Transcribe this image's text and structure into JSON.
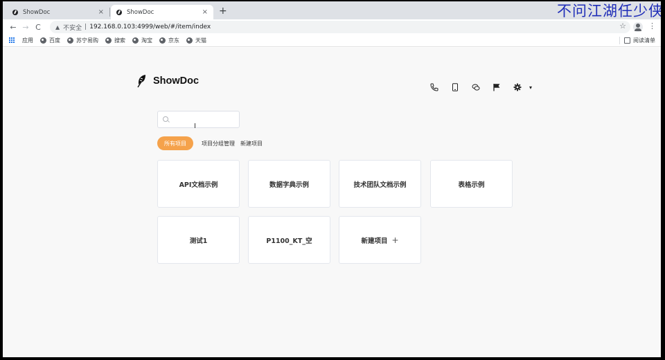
{
  "browser": {
    "tabs": [
      {
        "title": "ShowDoc",
        "close": "×",
        "active": false
      },
      {
        "title": "ShowDoc",
        "close": "×",
        "active": true
      }
    ],
    "new_tab": "+",
    "back": "←",
    "forward": "→",
    "reload": "C",
    "security_warning": "▲",
    "insecure_label": "不安全",
    "separator": "|",
    "url": "192.168.0.103:4999/web/#/item/index",
    "star": "☆",
    "menu": "⋮",
    "bookmarks": [
      "应用",
      "百度",
      "苏宁易购",
      "搜索",
      "淘宝",
      "京东",
      "天猫"
    ],
    "reading_list": "阅读清单"
  },
  "overlay_text": "不问江湖任少侠",
  "app": {
    "brand": "ShowDoc",
    "header_icons": [
      "phone-icon",
      "tablet-icon",
      "chat-icon",
      "flag-icon",
      "gear-icon"
    ],
    "caret": "▾",
    "search": {
      "value": "",
      "placeholder": ""
    },
    "cursor": "I",
    "filters": {
      "all_projects": "所有项目",
      "group_manage": "项目分组管理",
      "new_project": "新建项目"
    },
    "projects": [
      "API文档示例",
      "数据字典示例",
      "技术团队文档示例",
      "表格示例",
      "测试1",
      "P1100_KT_空"
    ],
    "new_project_card": {
      "label": "新建项目",
      "plus": "+"
    },
    "accent": "#f5a24b"
  }
}
